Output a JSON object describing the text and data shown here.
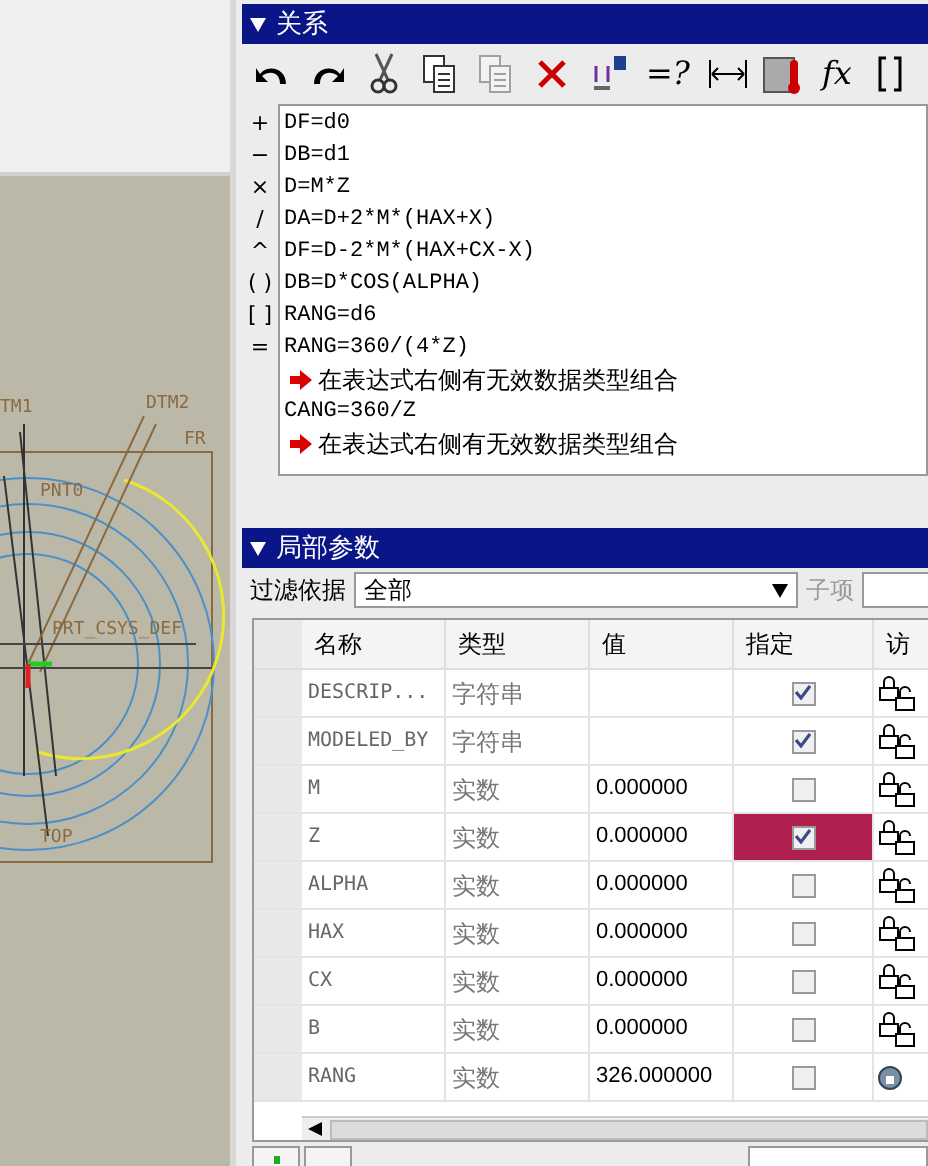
{
  "viewport": {
    "labels": [
      {
        "text": "TM1"
      },
      {
        "text": "DTM2"
      },
      {
        "text": "FR"
      },
      {
        "text": "PNT0"
      },
      {
        "text": "PRT_CSYS_DEF"
      },
      {
        "text": "TOP"
      }
    ]
  },
  "relations": {
    "title": "关系",
    "toolbar": [
      {
        "kind": "undo"
      },
      {
        "kind": "redo"
      },
      {
        "kind": "cut"
      },
      {
        "kind": "copy"
      },
      {
        "kind": "paste",
        "disabled": true
      },
      {
        "kind": "delete"
      },
      {
        "kind": "dims"
      },
      {
        "kind": "text",
        "label": "=?"
      },
      {
        "kind": "measure"
      },
      {
        "kind": "thermo"
      },
      {
        "kind": "text",
        "label": "fx"
      },
      {
        "kind": "bracket"
      }
    ],
    "operators": [
      "+",
      "−",
      "×",
      "/",
      "^",
      "( )",
      "[ ]",
      "="
    ],
    "lines": [
      {
        "kind": "line",
        "text": "DF=d0"
      },
      {
        "kind": "line",
        "text": "DB=d1"
      },
      {
        "kind": "line",
        "text": "D=M*Z"
      },
      {
        "kind": "line",
        "text": "DA=D+2*M*(HAX+X)"
      },
      {
        "kind": "line",
        "text": "DF=D-2*M*(HAX+CX-X)"
      },
      {
        "kind": "line",
        "text": "DB=D*COS(ALPHA)"
      },
      {
        "kind": "line",
        "text": "RANG=d6"
      },
      {
        "kind": "line",
        "text": "RANG=360/(4*Z)"
      },
      {
        "kind": "error",
        "text": "在表达式右侧有无效数据类型组合"
      },
      {
        "kind": "line",
        "text": "CANG=360/Z"
      },
      {
        "kind": "error",
        "text": "在表达式右侧有无效数据类型组合"
      }
    ]
  },
  "parameters": {
    "title": "局部参数",
    "filter_label": "过滤依据",
    "filter_value": "全部",
    "sub_label": "子项",
    "columns": [
      "名称",
      "类型",
      "值",
      "指定",
      "访"
    ],
    "rows": [
      {
        "name": "DESCRIP...",
        "type": "字符串",
        "value": "",
        "checked": true,
        "selected": false,
        "locked": true
      },
      {
        "name": "MODELED_BY",
        "type": "字符串",
        "value": "",
        "checked": true,
        "selected": false,
        "locked": true
      },
      {
        "name": "M",
        "type": "实数",
        "value": "0.000000",
        "checked": false,
        "selected": false,
        "locked": true
      },
      {
        "name": "Z",
        "type": "实数",
        "value": "0.000000",
        "checked": true,
        "selected": true,
        "locked": true
      },
      {
        "name": "ALPHA",
        "type": "实数",
        "value": "0.000000",
        "checked": false,
        "selected": false,
        "locked": true
      },
      {
        "name": "HAX",
        "type": "实数",
        "value": "0.000000",
        "checked": false,
        "selected": false,
        "locked": true
      },
      {
        "name": "CX",
        "type": "实数",
        "value": "0.000000",
        "checked": false,
        "selected": false,
        "locked": true
      },
      {
        "name": "B",
        "type": "实数",
        "value": "0.000000",
        "checked": false,
        "selected": false,
        "locked": true
      },
      {
        "name": "RANG",
        "type": "实数",
        "value": "326.000000",
        "checked": false,
        "selected": false,
        "locked": false
      }
    ]
  }
}
